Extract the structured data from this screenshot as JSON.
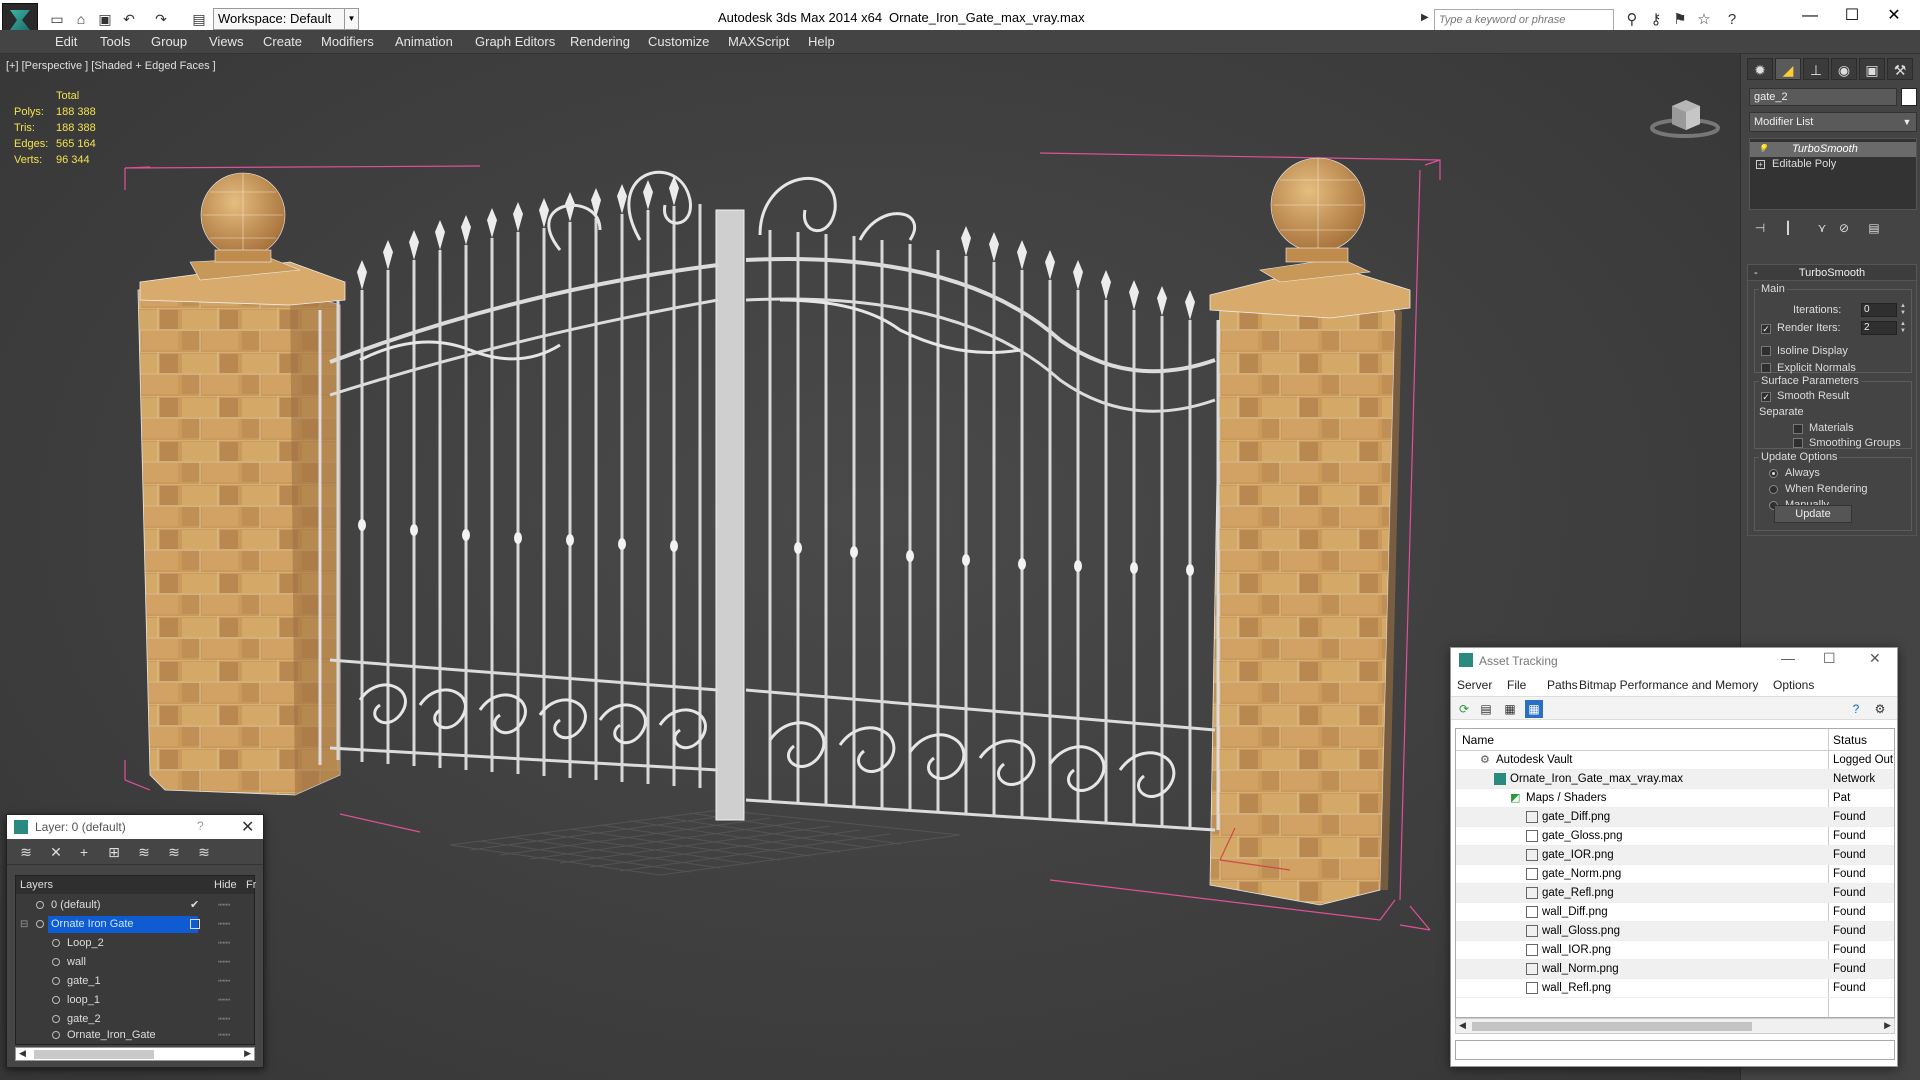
{
  "titlebar": {
    "workspace": "Workspace: Default",
    "app_title": "Autodesk 3ds Max  2014 x64",
    "file_title": "Ornate_Iron_Gate_max_vray.max",
    "search_placeholder": "Type a keyword or phrase"
  },
  "menu": [
    "Edit",
    "Tools",
    "Group",
    "Views",
    "Create",
    "Modifiers",
    "Animation",
    "Graph Editors",
    "Rendering",
    "Customize",
    "MAXScript",
    "Help"
  ],
  "viewport": {
    "label": "[+] [Perspective ] [Shaded + Edged Faces ]",
    "stats": {
      "header": "Total",
      "polys_label": "Polys:",
      "polys": "188 388",
      "tris_label": "Tris:",
      "tris": "188 388",
      "edges_label": "Edges:",
      "edges": "565 164",
      "verts_label": "Verts:",
      "verts": "96 344"
    }
  },
  "command_panel": {
    "object_name": "gate_2",
    "modifier_list": "Modifier List",
    "stack": [
      "TurboSmooth",
      "Editable Poly"
    ],
    "rollout_title": "TurboSmooth",
    "main_group": "Main",
    "iterations_label": "Iterations:",
    "iterations": "0",
    "render_iters_label": "Render Iters:",
    "render_iters": "2",
    "isoline": "Isoline Display",
    "explicit_normals": "Explicit Normals",
    "surface_group": "Surface Parameters",
    "smooth_result": "Smooth Result",
    "separate": "Separate",
    "materials": "Materials",
    "smoothing_groups": "Smoothing Groups",
    "update_group": "Update Options",
    "always": "Always",
    "when_rendering": "When Rendering",
    "manually": "Manually",
    "update_button": "Update"
  },
  "layer_window": {
    "title": "Layer: 0 (default)",
    "help": "?",
    "col_layers": "Layers",
    "col_hide": "Hide",
    "col_freeze": "Fre",
    "rows": [
      {
        "name": "0 (default)",
        "level": 0,
        "selected": false
      },
      {
        "name": "Ornate Iron Gate",
        "level": 0,
        "selected": true
      },
      {
        "name": "Loop_2",
        "level": 1,
        "selected": false
      },
      {
        "name": "wall",
        "level": 1,
        "selected": false
      },
      {
        "name": "gate_1",
        "level": 1,
        "selected": false
      },
      {
        "name": "loop_1",
        "level": 1,
        "selected": false
      },
      {
        "name": "gate_2",
        "level": 1,
        "selected": false
      },
      {
        "name": "Ornate_Iron_Gate",
        "level": 1,
        "selected": false
      }
    ]
  },
  "asset_window": {
    "title": "Asset Tracking",
    "menu": [
      "Server",
      "File",
      "Paths",
      "Bitmap Performance and Memory",
      "Options"
    ],
    "col_name": "Name",
    "col_status": "Status",
    "rows": [
      {
        "name": "Autodesk Vault",
        "status": "Logged Out",
        "level": 0
      },
      {
        "name": "Ornate_Iron_Gate_max_vray.max",
        "status": "Network Pat",
        "level": 1
      },
      {
        "name": "Maps / Shaders",
        "status": "",
        "level": 2
      },
      {
        "name": "gate_Diff.png",
        "status": "Found",
        "level": 3
      },
      {
        "name": "gate_Gloss.png",
        "status": "Found",
        "level": 3
      },
      {
        "name": "gate_IOR.png",
        "status": "Found",
        "level": 3
      },
      {
        "name": "gate_Norm.png",
        "status": "Found",
        "level": 3
      },
      {
        "name": "gate_Refl.png",
        "status": "Found",
        "level": 3
      },
      {
        "name": "wall_Diff.png",
        "status": "Found",
        "level": 3
      },
      {
        "name": "wall_Gloss.png",
        "status": "Found",
        "level": 3
      },
      {
        "name": "wall_IOR.png",
        "status": "Found",
        "level": 3
      },
      {
        "name": "wall_Norm.png",
        "status": "Found",
        "level": 3
      },
      {
        "name": "wall_Refl.png",
        "status": "Found",
        "level": 3
      }
    ]
  },
  "colors": {
    "stats_yellow": "#f2e24f",
    "selection_blue": "#0f5bd1",
    "bbox_pink": "#e0509a",
    "stone": "#c99a5a",
    "iron": "#e8e8e8"
  }
}
